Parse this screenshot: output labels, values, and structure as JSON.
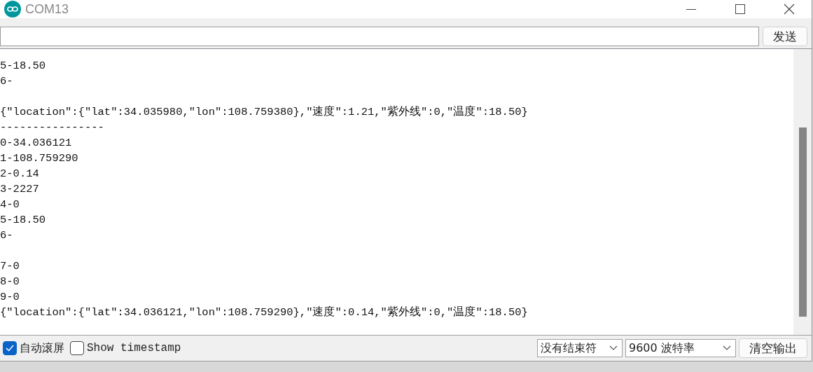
{
  "window": {
    "title": "COM13"
  },
  "send": {
    "button": "发送"
  },
  "output": [
    {
      "kind": "text",
      "text": "5-18.50"
    },
    {
      "kind": "text",
      "text": "6-"
    },
    {
      "kind": "blank"
    },
    {
      "kind": "text",
      "text": "{\"location\":{\"lat\":34.035980,\"lon\":108.759380},\"速度\":1.21,\"紫外线\":0,\"温度\":18.50}"
    },
    {
      "kind": "text",
      "text": "----------------"
    },
    {
      "kind": "text",
      "text": "0-34.036121"
    },
    {
      "kind": "text",
      "text": "1-108.759290"
    },
    {
      "kind": "text",
      "text": "2-0.14"
    },
    {
      "kind": "text",
      "text": "3-2227"
    },
    {
      "kind": "text",
      "text": "4-0"
    },
    {
      "kind": "text",
      "text": "5-18.50"
    },
    {
      "kind": "text",
      "text": "6-"
    },
    {
      "kind": "blank"
    },
    {
      "kind": "text",
      "text": "7-0"
    },
    {
      "kind": "text",
      "text": "8-0"
    },
    {
      "kind": "text",
      "text": "9-0"
    },
    {
      "kind": "text",
      "text": "{\"location\":{\"lat\":34.036121,\"lon\":108.759290},\"速度\":0.14,\"紫外线\":0,\"温度\":18.50}"
    }
  ],
  "footer": {
    "autoscroll": {
      "label": "自动滚屏",
      "checked": true
    },
    "timestamp": {
      "label": "Show timestamp",
      "checked": false
    },
    "line_ending": "没有结束符",
    "baud_rate": "9600 波特率",
    "clear_button": "清空输出"
  }
}
